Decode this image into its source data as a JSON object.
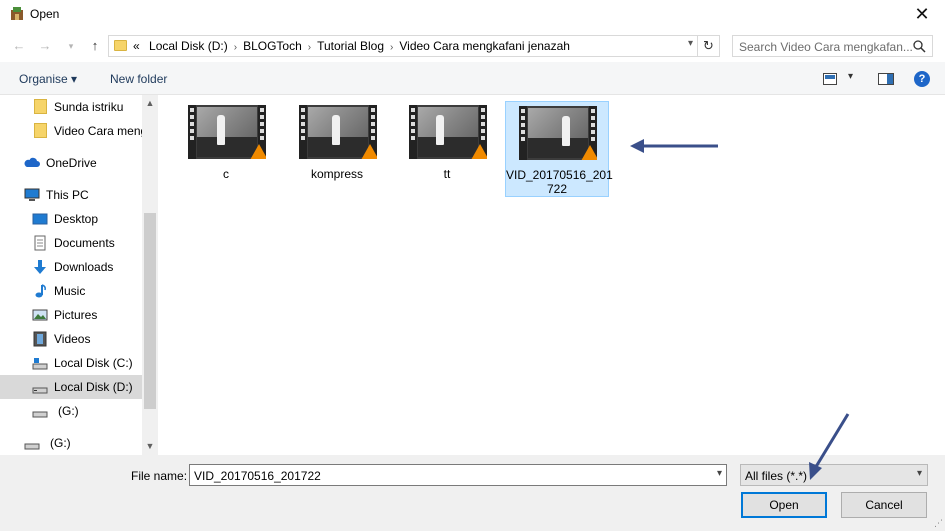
{
  "window": {
    "title": "Open",
    "close_label": "✕"
  },
  "address": {
    "crumbs": [
      "«",
      "Local Disk (D:)",
      "BLOGToch",
      "Tutorial Blog",
      "Video Cara mengkafani jenazah"
    ]
  },
  "search": {
    "placeholder": "Search Video Cara mengkafan..."
  },
  "toolbar": {
    "organise": "Organise ▾",
    "new_folder": "New folder",
    "help": "?"
  },
  "sidebar": {
    "items": [
      {
        "label": "Sunda istriku",
        "icon": "folder-icon"
      },
      {
        "label": "Video Cara meng",
        "icon": "folder-icon"
      },
      {
        "label": "OneDrive",
        "icon": "cloud-icon"
      },
      {
        "label": "This PC",
        "icon": "computer-icon"
      },
      {
        "label": "Desktop",
        "icon": "desktop-icon"
      },
      {
        "label": "Documents",
        "icon": "documents-icon"
      },
      {
        "label": "Downloads",
        "icon": "download-icon"
      },
      {
        "label": "Music",
        "icon": "music-icon"
      },
      {
        "label": "Pictures",
        "icon": "pictures-icon"
      },
      {
        "label": "Videos",
        "icon": "videos-icon"
      },
      {
        "label": "Local Disk (C:)",
        "icon": "drive-icon"
      },
      {
        "label": "Local Disk (D:)",
        "icon": "drive-icon",
        "selected": true
      },
      {
        "label": "(G:)",
        "icon": "drive-icon"
      },
      {
        "label": "(G:)",
        "icon": "drive-icon"
      }
    ]
  },
  "files": [
    {
      "name": "c"
    },
    {
      "name": "kompress"
    },
    {
      "name": "tt"
    },
    {
      "name": "VID_20170516_201722",
      "name_line1": "VID_20170516_201",
      "name_line2": "722",
      "selected": true
    }
  ],
  "footer": {
    "file_name_label": "File name:",
    "file_name_value": "VID_20170516_201722",
    "filter_value": "All files (*.*)",
    "open_label": "Open",
    "cancel_label": "Cancel"
  },
  "colors": {
    "annotation_arrow": "#3a4f8a",
    "selection": "#cce8ff"
  }
}
